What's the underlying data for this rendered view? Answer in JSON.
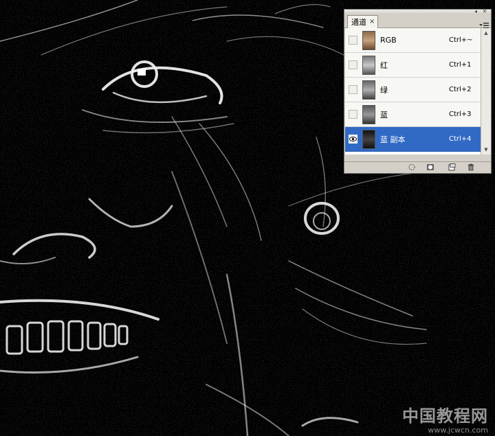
{
  "panel": {
    "tab_label": "通道",
    "tab_close": "×",
    "minimize": "◂",
    "close": "✕",
    "channels": [
      {
        "name": "RGB",
        "shortcut": "Ctrl+~",
        "visible": false,
        "selected": false
      },
      {
        "name": "红",
        "shortcut": "Ctrl+1",
        "visible": false,
        "selected": false
      },
      {
        "name": "绿",
        "shortcut": "Ctrl+2",
        "visible": false,
        "selected": false
      },
      {
        "name": "蓝",
        "shortcut": "Ctrl+3",
        "visible": false,
        "selected": false
      },
      {
        "name": "蓝 副本",
        "shortcut": "Ctrl+4",
        "visible": true,
        "selected": true
      }
    ],
    "footer_buttons": [
      "load-channel-as-selection",
      "save-selection-as-channel",
      "create-new-channel",
      "delete-channel"
    ]
  },
  "watermark": {
    "text": "中国教程网",
    "url": "www.jcwcn.com"
  },
  "colors": {
    "selection": "#316ac5",
    "panel_bg": "#d4d0c8",
    "canvas_bg": "#000000"
  }
}
